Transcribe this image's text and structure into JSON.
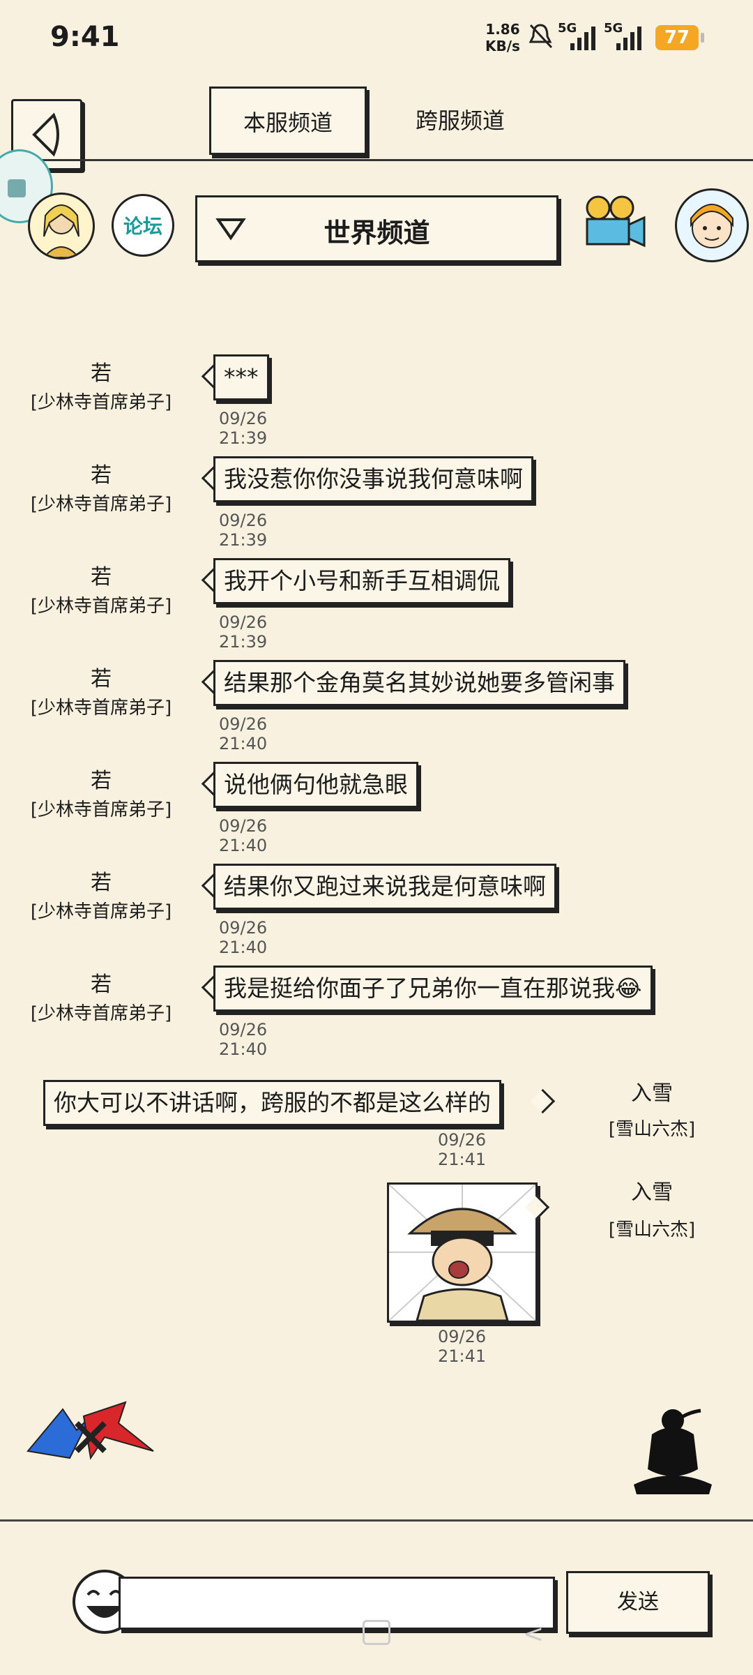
{
  "status_bar": {
    "time": "9:41",
    "speed_value": "1.86",
    "speed_unit": "KB/s",
    "net1": "5G",
    "net2": "5G",
    "battery": "77"
  },
  "tabs": {
    "local": "本服频道",
    "cross": "跨服频道"
  },
  "header": {
    "forum_label": "论坛",
    "channel": "世界频道"
  },
  "messages": [
    {
      "name": "若",
      "title": "[少林寺首席弟子]",
      "text": "***",
      "time": "09/26 21:39"
    },
    {
      "name": "若",
      "title": "[少林寺首席弟子]",
      "text": "我没惹你你没事说我何意味啊",
      "time": "09/26 21:39"
    },
    {
      "name": "若",
      "title": "[少林寺首席弟子]",
      "text": "我开个小号和新手互相调侃",
      "time": "09/26 21:39"
    },
    {
      "name": "若",
      "title": "[少林寺首席弟子]",
      "text": "结果那个金角莫名其妙说她要多管闲事",
      "time": "09/26 21:40"
    },
    {
      "name": "若",
      "title": "[少林寺首席弟子]",
      "text": "说他俩句他就急眼",
      "time": "09/26 21:40"
    },
    {
      "name": "若",
      "title": "[少林寺首席弟子]",
      "text": "结果你又跑过来说我是何意味啊",
      "time": "09/26 21:40"
    },
    {
      "name": "若",
      "title": "[少林寺首席弟子]",
      "text": "我是挺给你面子了兄弟你一直在那说我😂",
      "time": "09/26 21:40"
    }
  ],
  "my_messages": [
    {
      "name": "入雪",
      "title": "[雪山六杰]",
      "text": "你大可以不讲话啊，跨服的不都是这么样的",
      "time": "09/26 21:41"
    },
    {
      "name": "入雪",
      "title": "[雪山六杰]",
      "text": "",
      "time": "09/26 21:41"
    }
  ],
  "input": {
    "placeholder": "",
    "send_label": "发送"
  },
  "colors": {
    "background": "#f8f1df",
    "battery": "#f5a623",
    "forum_text": "#1a9a9a"
  }
}
